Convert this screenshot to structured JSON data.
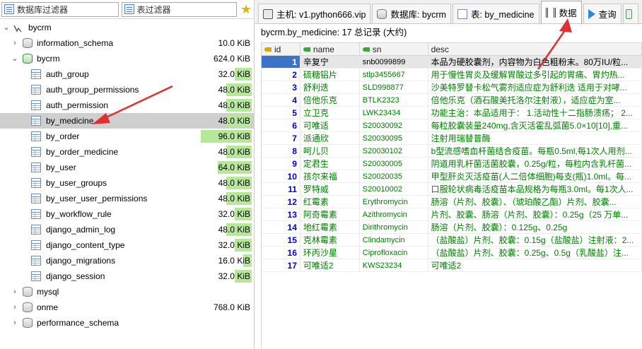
{
  "filters": {
    "db_filter_placeholder": "数据库过滤器",
    "table_filter_placeholder": "表过滤器"
  },
  "tree": {
    "server": "bycrm",
    "databases": [
      {
        "name": "information_schema",
        "size": "10.0 KiB"
      },
      {
        "name": "bycrm",
        "size": "624.0 KiB"
      }
    ],
    "tables": [
      {
        "name": "auth_group",
        "size": "32.0 KiB",
        "fill": 0.33
      },
      {
        "name": "auth_group_permissions",
        "size": "48.0 KiB",
        "fill": 0.5
      },
      {
        "name": "auth_permission",
        "size": "48.0 KiB",
        "fill": 0.5
      },
      {
        "name": "by_medicine",
        "size": "48.0 KiB",
        "fill": 0.5
      },
      {
        "name": "by_order",
        "size": "96.0 KiB",
        "fill": 1.0
      },
      {
        "name": "by_order_medicine",
        "size": "48.0 KiB",
        "fill": 0.5
      },
      {
        "name": "by_user",
        "size": "64.0 KiB",
        "fill": 0.67
      },
      {
        "name": "by_user_groups",
        "size": "48.0 KiB",
        "fill": 0.5
      },
      {
        "name": "by_user_user_permissions",
        "size": "48.0 KiB",
        "fill": 0.5
      },
      {
        "name": "by_workflow_rule",
        "size": "32.0 KiB",
        "fill": 0.33
      },
      {
        "name": "django_admin_log",
        "size": "48.0 KiB",
        "fill": 0.5
      },
      {
        "name": "django_content_type",
        "size": "32.0 KiB",
        "fill": 0.33
      },
      {
        "name": "django_migrations",
        "size": "16.0 KiB",
        "fill": 0.17
      },
      {
        "name": "django_session",
        "size": "32.0 KiB",
        "fill": 0.33
      }
    ],
    "other_databases": [
      {
        "name": "mysql",
        "size": ""
      },
      {
        "name": "onme",
        "size": "768.0 KiB"
      },
      {
        "name": "performance_schema",
        "size": ""
      }
    ]
  },
  "tabs": [
    {
      "label": "主机: v1.python666.vip",
      "icon": "host-icon"
    },
    {
      "label": "数据库: bycrm",
      "icon": "database-icon"
    },
    {
      "label": "表: by_medicine",
      "icon": "table-icon"
    },
    {
      "label": "数据",
      "icon": "data-icon"
    },
    {
      "label": "查询",
      "icon": "query-icon"
    }
  ],
  "info_line": "bycrm.by_medicine: 17 总记录 (大约)",
  "columns": [
    "id",
    "name",
    "sn",
    "desc"
  ],
  "rows": [
    [
      "1",
      "辛复宁",
      "snb0099899",
      "本品为硬胶囊剂，内容物为白色粗粉末。80万IU/粒..."
    ],
    [
      "2",
      "硫糖铝片",
      "stlp3455667",
      "用于慢性胃炎及缓解胃酸过多引起的胃痛、胃灼热..."
    ],
    [
      "3",
      "舒利迭",
      "SLD998877",
      "沙美特罗替卡松气雾剂适应症为舒利迭 适用于对哮..."
    ],
    [
      "4",
      "倍他乐克",
      "BTLK2323",
      "倍他乐克（酒石酸美托洛尔注射液），适应症为室..."
    ],
    [
      "5",
      "立卫克",
      "LWK23434",
      "功能主治：本品适用于： 1.活动性十二指肠溃疡； 2..."
    ],
    [
      "6",
      "可唯适",
      "S20030092",
      "每粒胶囊装量240mg,含灭活霍乱弧菌5.0×10[10],重..."
    ],
    [
      "7",
      "派通欣",
      "S20030095",
      "注射用瑞替普酶"
    ],
    [
      "8",
      "呵儿贝",
      "S20030102",
      "b型流感嗜血杆菌结合疫苗。每瓶0.5ml,每1次人用剂..."
    ],
    [
      "9",
      "定君生",
      "S20030005",
      "阴道用乳杆菌活菌胶囊，0.25g/粒，每粒内含乳杆菌..."
    ],
    [
      "10",
      "孩尔来福",
      "S20020035",
      "甲型肝炎灭活疫苗(人二倍体细胞)每支(瓶)1.0ml。每..."
    ],
    [
      "11",
      "罗特威",
      "S20010002",
      "口服轮状病毒活疫苗本品规格为每瓶3.0ml。每1次人..."
    ],
    [
      "12",
      "红霉素",
      "Erythromycin",
      "肠溶（片剂、胶囊）、（琥珀酸乙酯）片剂、胶囊..."
    ],
    [
      "13",
      "阿奇霉素",
      "Azithromycin",
      "片剂、胶囊、肠溶（片剂、胶囊）：0.25g（25 万单..."
    ],
    [
      "14",
      "地红霉素",
      "Dirithromycin",
      "肠溶（片剂、胶囊）：0.125g、0.25g"
    ],
    [
      "15",
      "克林霉素",
      "Clindamycin",
      "（盐酸盐）片剂、胶囊：0.15g（盐酸盐）注射液：2..."
    ],
    [
      "16",
      "环丙沙星",
      "Ciprofloxacin",
      "（盐酸盐）片剂、胶囊：0.25g、0.5g（乳酸盐）注..."
    ],
    [
      "17",
      "可唯适2",
      "KWS23234",
      "可唯适2"
    ]
  ],
  "colors": {
    "selected_id_bg": "#3b73c8",
    "size_bar": "#b7e89a",
    "value_text": "#008000",
    "id_text": "#0000d0",
    "annotation_arrow": "#e03030"
  }
}
